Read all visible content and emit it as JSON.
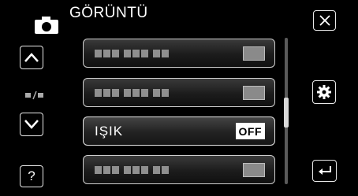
{
  "header": {
    "title": "GÖRÜNTÜ",
    "icon": "camera-icon"
  },
  "left_buttons": {
    "up_icon": "chevron-up-icon",
    "mode_icon": "video-photo-mode-icon",
    "down_icon": "chevron-down-icon",
    "help_label": "?"
  },
  "right_buttons": {
    "close_icon": "close-icon",
    "settings_icon": "gear-icon",
    "back_icon": "return-icon"
  },
  "menu": {
    "items": [
      {
        "label": "",
        "value": "",
        "state": "disabled"
      },
      {
        "label": "",
        "value": "",
        "state": "disabled"
      },
      {
        "label": "IŞIK",
        "value": "OFF",
        "state": "selected"
      },
      {
        "label": "",
        "value": "",
        "state": "disabled"
      }
    ]
  },
  "colors": {
    "background": "#000000",
    "text": "#ffffff",
    "disabled_text": "#8f8f8f"
  }
}
